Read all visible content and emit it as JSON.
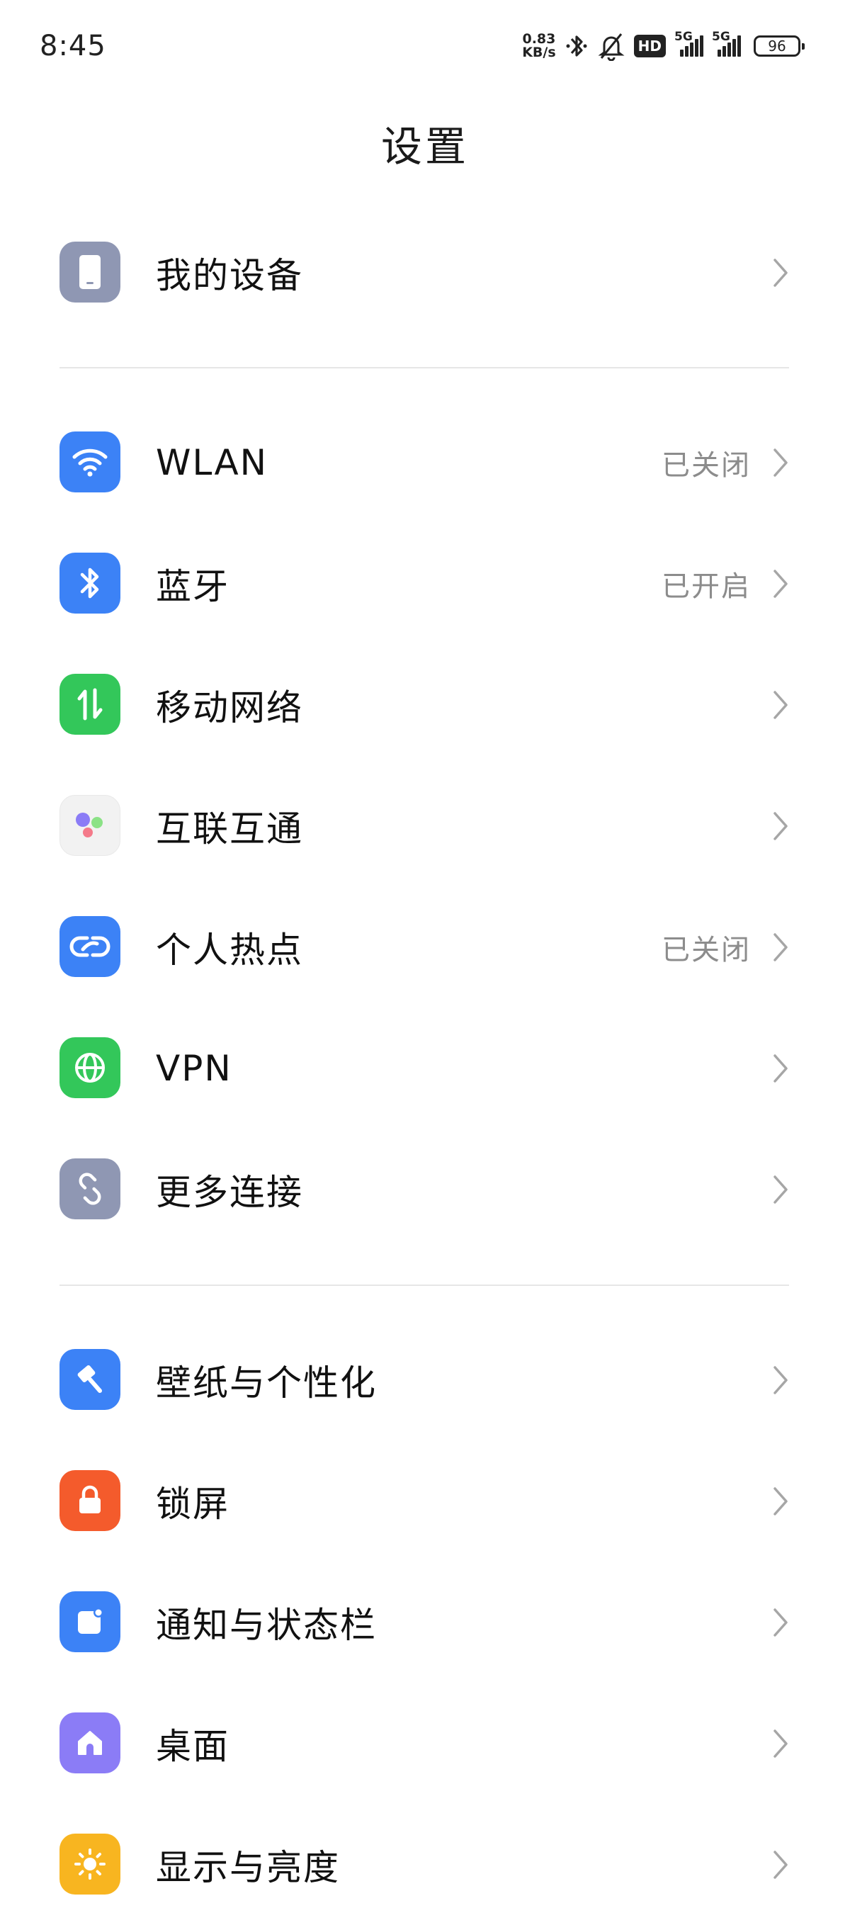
{
  "status_bar": {
    "time": "8:45",
    "net_speed_value": "0.83",
    "net_speed_unit": "KB/s",
    "icons": [
      "bluetooth-icon",
      "silent-bell-icon",
      "hd-volte-icon",
      "signal-5g-icon",
      "signal-5g-icon"
    ],
    "hd_label": "HD",
    "sim1_label": "5G",
    "sim2_label": "5G",
    "battery": "96"
  },
  "page": {
    "title": "设置"
  },
  "colors": {
    "blue": "#3c82f6",
    "green": "#33c75a",
    "gray": "#8f97b3",
    "orange": "#f45b2c",
    "purple": "#8b7cf6",
    "yellow": "#f8b520",
    "value_text": "#8c8c8c"
  },
  "sections": [
    {
      "items": [
        {
          "label": "我的设备",
          "value": "",
          "icon": "phone-icon"
        }
      ]
    },
    {
      "items": [
        {
          "label": "WLAN",
          "value": "已关闭",
          "icon": "wifi-icon"
        },
        {
          "label": "蓝牙",
          "value": "已开启",
          "icon": "bluetooth-icon"
        },
        {
          "label": "移动网络",
          "value": "",
          "icon": "mobile-data-icon"
        },
        {
          "label": "互联互通",
          "value": "",
          "icon": "interconnect-icon"
        },
        {
          "label": "个人热点",
          "value": "已关闭",
          "icon": "hotspot-icon"
        },
        {
          "label": "VPN",
          "value": "",
          "icon": "globe-icon"
        },
        {
          "label": "更多连接",
          "value": "",
          "icon": "link-icon"
        }
      ]
    },
    {
      "items": [
        {
          "label": "壁纸与个性化",
          "value": "",
          "icon": "brush-icon"
        },
        {
          "label": "锁屏",
          "value": "",
          "icon": "lock-icon"
        },
        {
          "label": "通知与状态栏",
          "value": "",
          "icon": "notification-icon"
        },
        {
          "label": "桌面",
          "value": "",
          "icon": "home-icon"
        },
        {
          "label": "显示与亮度",
          "value": "",
          "icon": "brightness-icon"
        }
      ]
    }
  ]
}
